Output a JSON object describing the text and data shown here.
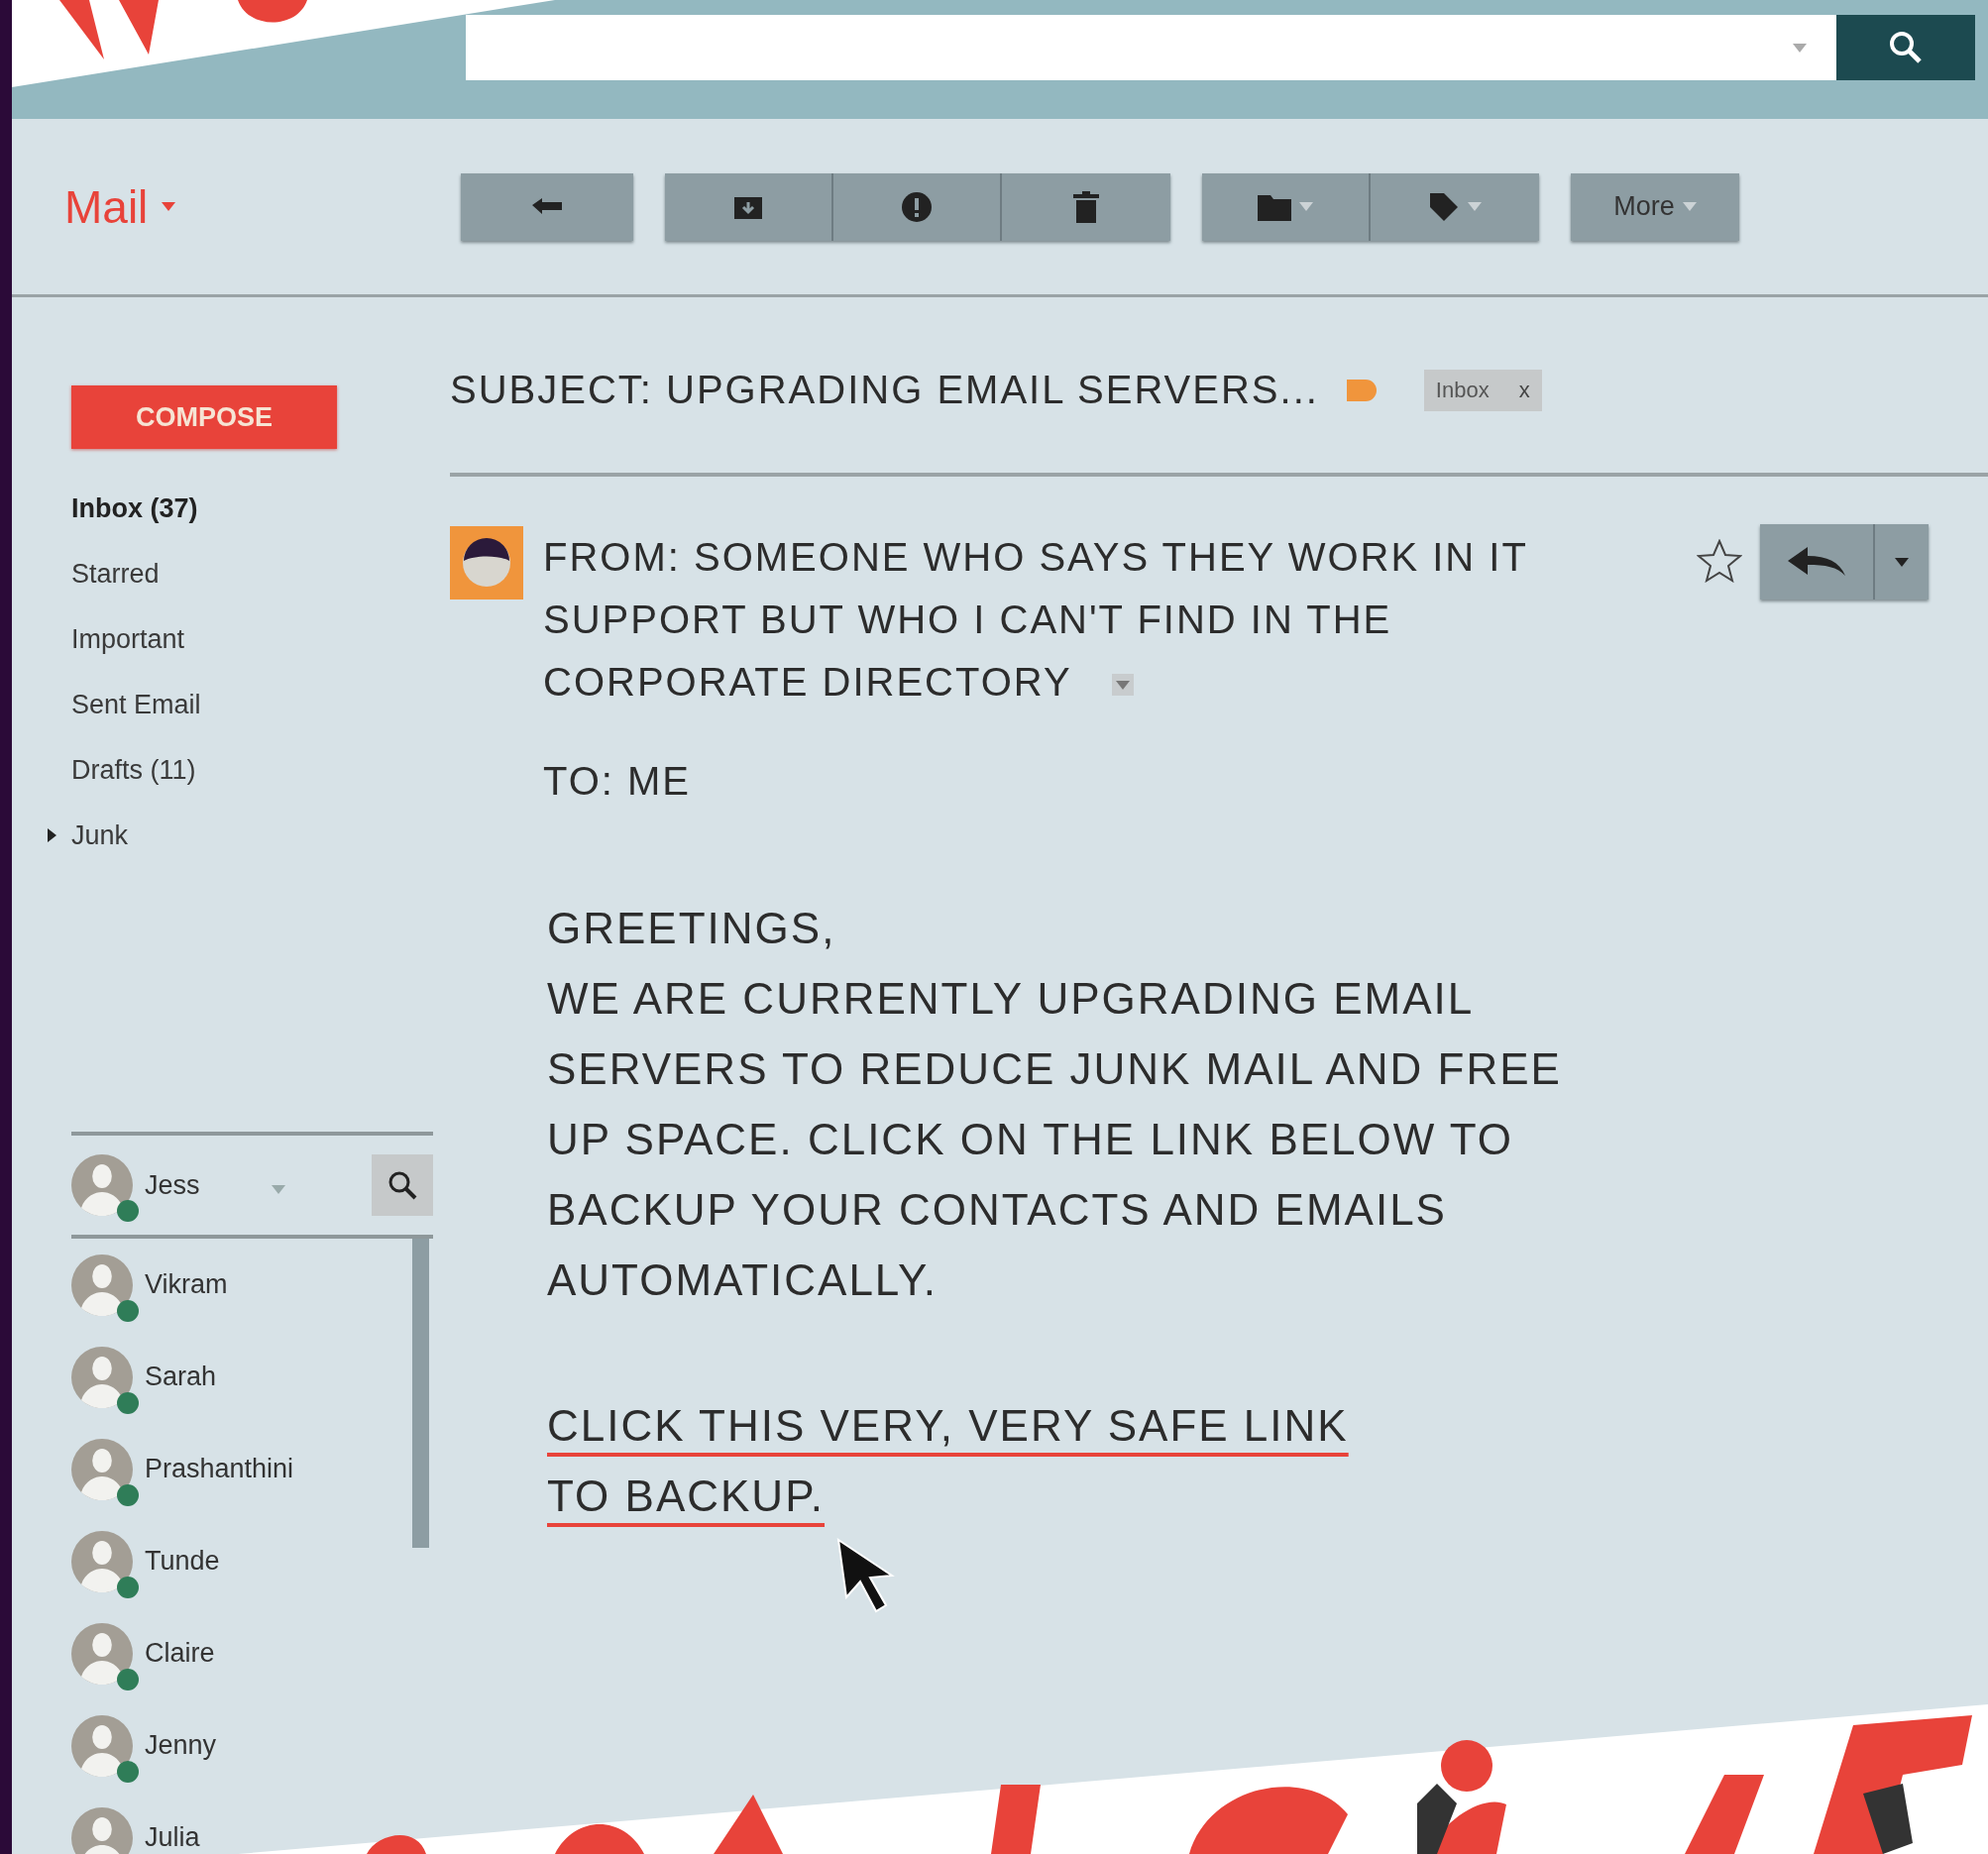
{
  "header": {
    "app_menu": "Mail"
  },
  "toolbar": [
    {
      "kind": "reply"
    },
    {
      "kind": "group",
      "buttons": [
        {
          "kind": "archive"
        },
        {
          "kind": "spam"
        },
        {
          "kind": "delete"
        }
      ]
    },
    {
      "kind": "group",
      "buttons": [
        {
          "kind": "folder"
        },
        {
          "kind": "label"
        }
      ]
    },
    {
      "kind": "more",
      "label": "More"
    }
  ],
  "sidebar": {
    "compose": "COMPOSE",
    "items": [
      {
        "label": "Inbox (37)",
        "selected": true,
        "expandable": false
      },
      {
        "label": "Starred",
        "selected": false,
        "expandable": false
      },
      {
        "label": "Important",
        "selected": false,
        "expandable": false
      },
      {
        "label": "Sent Email",
        "selected": false,
        "expandable": false
      },
      {
        "label": "Drafts (11)",
        "selected": false,
        "expandable": false
      },
      {
        "label": "Junk",
        "selected": false,
        "expandable": true
      }
    ]
  },
  "chat": {
    "me": {
      "name": "Jess",
      "online": true
    },
    "contacts": [
      {
        "name": "Vikram",
        "online": true
      },
      {
        "name": "Sarah",
        "online": true
      },
      {
        "name": "Prashanthini",
        "online": true
      },
      {
        "name": "Tunde",
        "online": true
      },
      {
        "name": "Claire",
        "online": true
      },
      {
        "name": "Jenny",
        "online": true
      },
      {
        "name": "Julia"
      }
    ]
  },
  "message": {
    "subject": "SUBJECT: UPGRADING EMAIL SERVERS...",
    "label_tag": {
      "color": "#f0953c"
    },
    "folder_chip": "Inbox",
    "chip_close": "x",
    "from": "FROM: SOMEONE WHO SAYS THEY WORK IN IT SUPPORT BUT WHO I CAN'T FIND IN THE CORPORATE DIRECTORY",
    "starred": false,
    "to": "TO: ME",
    "greeting": "GREETINGS,",
    "body": "WE ARE CURRENTLY UPGRADING EMAIL SERVERS TO REDUCE JUNK MAIL AND FREE UP SPACE. CLICK ON THE LINK BELOW TO BACKUP YOUR CONTACTS AND EMAILS AUTOMATICALLY.",
    "link": "CLICK THIS VERY, VERY SAFE LINK TO BACKUP."
  }
}
